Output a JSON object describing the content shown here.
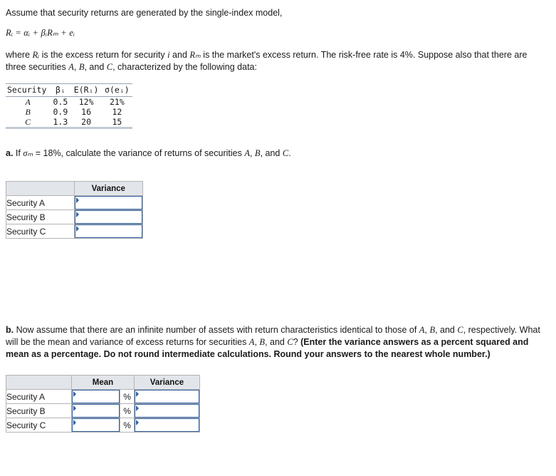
{
  "intro": {
    "line1": "Assume that security returns are generated by the single-index model,",
    "formula": "Rᵢ = αᵢ + βᵢRₘ + eᵢ",
    "line2_a": "where ",
    "line2_b": " is the excess return for security ",
    "line2_c": " and ",
    "line2_d": " is the market's excess return. The risk-free rate is 4%. Suppose also that there are three securities ",
    "line2_e": ", ",
    "line2_f": ", and ",
    "line2_g": ", characterized by the following data:",
    "var_Ri": "Rᵢ",
    "var_i": "i",
    "var_RM": "Rₘ",
    "sec_A": "A",
    "sec_B": "B",
    "sec_C": "C"
  },
  "data_table": {
    "headers": [
      "Security",
      "βᵢ",
      "E(Rᵢ)",
      "σ(eᵢ)"
    ],
    "rows": [
      {
        "security": "A",
        "beta": "0.5",
        "er": "12%",
        "sigma_e": "21%"
      },
      {
        "security": "B",
        "beta": "0.9",
        "er": "16",
        "sigma_e": "12"
      },
      {
        "security": "C",
        "beta": "1.3",
        "er": "20",
        "sigma_e": "15"
      }
    ]
  },
  "part_a": {
    "label": "a.",
    "text_1": " If ",
    "sigma_M": "σₘ",
    "text_2": " = 18%, calculate the variance of returns of securities ",
    "sec_A": "A",
    "sep1": ", ",
    "sec_B": "B",
    "sep2": ", and ",
    "sec_C": "C",
    "end": ".",
    "table": {
      "header_blank": "",
      "header_variance": "Variance",
      "rows": [
        {
          "label": "Security A",
          "variance": ""
        },
        {
          "label": "Security B",
          "variance": ""
        },
        {
          "label": "Security C",
          "variance": ""
        }
      ]
    }
  },
  "part_b": {
    "label": "b.",
    "text_1": " Now assume that there are an infinite number of assets with return characteristics identical to those of ",
    "sec_A": "A",
    "sep1": ", ",
    "sec_B": "B",
    "sep2": ", and ",
    "sec_C": "C",
    "text_2": ", respectively. What will be the mean and variance of excess returns for securities ",
    "sec_A2": "A",
    "sep3": ", ",
    "sec_B2": "B",
    "sep4": ", and ",
    "sec_C2": "C",
    "text_3": "? ",
    "bold_note": "(Enter the variance answers as a percent squared and mean as a percentage. Do not round intermediate calculations. Round your answers to the nearest whole number.)",
    "table": {
      "header_blank": "",
      "header_mean": "Mean",
      "header_variance": "Variance",
      "percent_sign": "%",
      "rows": [
        {
          "label": "Security A",
          "mean": "",
          "variance": ""
        },
        {
          "label": "Security B",
          "mean": "",
          "variance": ""
        },
        {
          "label": "Security C",
          "mean": "",
          "variance": ""
        }
      ]
    }
  }
}
